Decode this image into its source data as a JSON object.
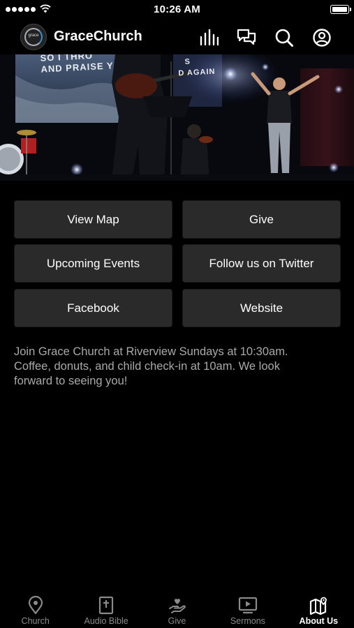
{
  "status_bar": {
    "time": "10:26 AM"
  },
  "header": {
    "logo_text": "grace",
    "title": "GraceChurch"
  },
  "hero": {
    "screen_text_line1": "SO I THRO",
    "screen_text_line2": "AND PRAISE Y",
    "screen_text_right1": "S",
    "screen_text_right2": "D AGAIN"
  },
  "buttons": [
    {
      "label": "View Map"
    },
    {
      "label": "Give"
    },
    {
      "label": "Upcoming Events"
    },
    {
      "label": "Follow us on Twitter"
    },
    {
      "label": "Facebook"
    },
    {
      "label": "Website"
    }
  ],
  "description": {
    "line1": "Join Grace Church at Riverview Sundays at 10:30am.",
    "line2": "Coffee, donuts, and child check-in at 10am.  We look",
    "line3": "forward to seeing you!"
  },
  "tabs": [
    {
      "label": "Church",
      "icon": "location-pin-icon",
      "active": false
    },
    {
      "label": "Audio Bible",
      "icon": "bible-icon",
      "active": false
    },
    {
      "label": "Give",
      "icon": "giving-hand-icon",
      "active": false
    },
    {
      "label": "Sermons",
      "icon": "video-play-icon",
      "active": false
    },
    {
      "label": "About Us",
      "icon": "map-pin-icon",
      "active": true
    }
  ],
  "colors": {
    "background": "#000000",
    "button_bg": "#2a2a2a",
    "text_muted": "#a9a9a9",
    "tab_inactive": "#8a8a8a",
    "tab_active": "#ffffff"
  }
}
